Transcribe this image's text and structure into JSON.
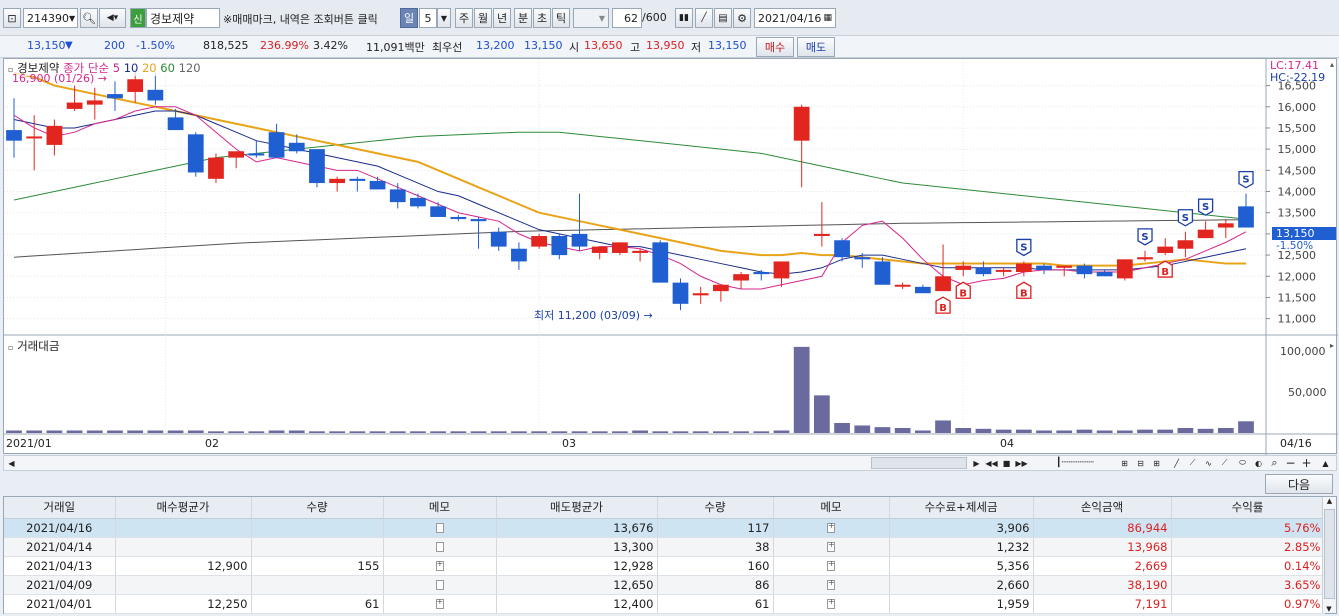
{
  "toolbar": {
    "code": "214390",
    "credit_badge": "신",
    "stock_name": "경보제약",
    "notice": "※매매마크, 내역은 조회버튼 클릭",
    "periods": [
      "일",
      "5",
      "주",
      "월",
      "년",
      "분",
      "초",
      "틱"
    ],
    "count": "62",
    "count_total": "/600",
    "date": "2021/04/16"
  },
  "quote": {
    "price": "13,150",
    "arrow": "▼",
    "change": "200",
    "change_pct": "-1.50%",
    "volume": "818,525",
    "vol_ratio": "236.99%",
    "turnover": "3.42%",
    "amount": "11,091백만",
    "best_label": "최우선",
    "best_ask": "13,200",
    "best_bid": "13,150",
    "open_label": "시",
    "open": "13,650",
    "high_label": "고",
    "high": "13,950",
    "low_label": "저",
    "low": "13,150",
    "buy_label": "매수",
    "sell_label": "매도"
  },
  "price_panel": {
    "name": "경보제약",
    "ma_label": "종가 단순",
    "ma_periods": [
      "5",
      "10",
      "20",
      "60",
      "120"
    ],
    "lc": "LC:17.41",
    "hc": "HC:-22.19",
    "high_annotation": "16,900 (01/26)",
    "low_annotation": "최저 11,200 (03/09)",
    "current_price_tag": "13,150",
    "current_pct_tag": "-1.50%"
  },
  "volume_panel": {
    "title": "거래대금",
    "axis": [
      "100,000",
      "50,000"
    ]
  },
  "x_axis": {
    "labels": [
      "2021/01",
      "02",
      "03",
      "04"
    ],
    "end_label": "04/16"
  },
  "chart_data": {
    "type": "candlestick",
    "y_axis_ticks": [
      16500,
      16000,
      15500,
      15000,
      14500,
      14000,
      13500,
      13000,
      12500,
      12000,
      11500,
      11000
    ],
    "candles": [
      {
        "o": 15450,
        "h": 16200,
        "l": 14800,
        "c": 15200
      },
      {
        "o": 15300,
        "h": 15800,
        "l": 14500,
        "c": 15300
      },
      {
        "o": 15100,
        "h": 15700,
        "l": 14850,
        "c": 15550
      },
      {
        "o": 15950,
        "h": 16500,
        "l": 15900,
        "c": 16100
      },
      {
        "o": 16050,
        "h": 16450,
        "l": 15700,
        "c": 16150
      },
      {
        "o": 16300,
        "h": 16600,
        "l": 15900,
        "c": 16200
      },
      {
        "o": 16350,
        "h": 16900,
        "l": 16100,
        "c": 16650
      },
      {
        "o": 16400,
        "h": 16800,
        "l": 16050,
        "c": 16150
      },
      {
        "o": 15750,
        "h": 15950,
        "l": 15500,
        "c": 15450
      },
      {
        "o": 15350,
        "h": 15400,
        "l": 14350,
        "c": 14450
      },
      {
        "o": 14300,
        "h": 14900,
        "l": 14200,
        "c": 14800
      },
      {
        "o": 14800,
        "h": 14950,
        "l": 14550,
        "c": 14950
      },
      {
        "o": 14900,
        "h": 15200,
        "l": 14800,
        "c": 14850
      },
      {
        "o": 15400,
        "h": 15600,
        "l": 14800,
        "c": 14800
      },
      {
        "o": 15150,
        "h": 15350,
        "l": 14900,
        "c": 14950
      },
      {
        "o": 15000,
        "h": 15000,
        "l": 14100,
        "c": 14200
      },
      {
        "o": 14200,
        "h": 14350,
        "l": 14000,
        "c": 14300
      },
      {
        "o": 14300,
        "h": 14350,
        "l": 14000,
        "c": 14250
      },
      {
        "o": 14250,
        "h": 14350,
        "l": 14050,
        "c": 14050
      },
      {
        "o": 14050,
        "h": 14200,
        "l": 13600,
        "c": 13750
      },
      {
        "o": 13850,
        "h": 13950,
        "l": 13600,
        "c": 13650
      },
      {
        "o": 13650,
        "h": 13750,
        "l": 13450,
        "c": 13400
      },
      {
        "o": 13400,
        "h": 13450,
        "l": 13300,
        "c": 13350
      },
      {
        "o": 13350,
        "h": 13400,
        "l": 12650,
        "c": 13300
      },
      {
        "o": 13050,
        "h": 13150,
        "l": 12600,
        "c": 12700
      },
      {
        "o": 12650,
        "h": 12800,
        "l": 12150,
        "c": 12350
      },
      {
        "o": 12700,
        "h": 13000,
        "l": 12650,
        "c": 12950
      },
      {
        "o": 12950,
        "h": 13000,
        "l": 12400,
        "c": 12500
      },
      {
        "o": 13000,
        "h": 13950,
        "l": 12600,
        "c": 12700
      },
      {
        "o": 12550,
        "h": 12700,
        "l": 12400,
        "c": 12700
      },
      {
        "o": 12550,
        "h": 12800,
        "l": 12500,
        "c": 12800
      },
      {
        "o": 12550,
        "h": 12650,
        "l": 12350,
        "c": 12600
      },
      {
        "o": 12800,
        "h": 12850,
        "l": 11900,
        "c": 11850
      },
      {
        "o": 11850,
        "h": 11950,
        "l": 11200,
        "c": 11350
      },
      {
        "o": 11550,
        "h": 11750,
        "l": 11350,
        "c": 11600
      },
      {
        "o": 11650,
        "h": 11800,
        "l": 11400,
        "c": 11800
      },
      {
        "o": 11900,
        "h": 12100,
        "l": 11700,
        "c": 12050
      },
      {
        "o": 12100,
        "h": 12150,
        "l": 11900,
        "c": 12050
      },
      {
        "o": 11950,
        "h": 12300,
        "l": 11750,
        "c": 12350
      },
      {
        "o": 15200,
        "h": 16050,
        "l": 14100,
        "c": 16000
      },
      {
        "o": 12950,
        "h": 13750,
        "l": 12700,
        "c": 13000
      },
      {
        "o": 12850,
        "h": 12900,
        "l": 12350,
        "c": 12450
      },
      {
        "o": 12450,
        "h": 12550,
        "l": 12200,
        "c": 12400
      },
      {
        "o": 12350,
        "h": 12450,
        "l": 11800,
        "c": 11800
      },
      {
        "o": 11800,
        "h": 11850,
        "l": 11700,
        "c": 11800
      },
      {
        "o": 11750,
        "h": 11800,
        "l": 11600,
        "c": 11600
      },
      {
        "o": 11650,
        "h": 12750,
        "l": 11650,
        "c": 12000
      },
      {
        "o": 12150,
        "h": 12350,
        "l": 12000,
        "c": 12250
      },
      {
        "o": 12200,
        "h": 12350,
        "l": 12000,
        "c": 12050
      },
      {
        "o": 12150,
        "h": 12200,
        "l": 12000,
        "c": 12150
      },
      {
        "o": 12100,
        "h": 12350,
        "l": 12000,
        "c": 12300
      },
      {
        "o": 12250,
        "h": 12300,
        "l": 12050,
        "c": 12150
      },
      {
        "o": 12200,
        "h": 12250,
        "l": 12000,
        "c": 12250
      },
      {
        "o": 12250,
        "h": 12300,
        "l": 11950,
        "c": 12050
      },
      {
        "o": 12100,
        "h": 12150,
        "l": 12000,
        "c": 12000
      },
      {
        "o": 11950,
        "h": 12400,
        "l": 11900,
        "c": 12400
      },
      {
        "o": 12400,
        "h": 12600,
        "l": 12350,
        "c": 12450
      },
      {
        "o": 12550,
        "h": 12900,
        "l": 12500,
        "c": 12700
      },
      {
        "o": 12650,
        "h": 13050,
        "l": 12450,
        "c": 12850
      },
      {
        "o": 12900,
        "h": 13300,
        "l": 12900,
        "c": 13100
      },
      {
        "o": 13150,
        "h": 13350,
        "l": 12900,
        "c": 13250
      },
      {
        "o": 13650,
        "h": 13950,
        "l": 13150,
        "c": 13150
      }
    ],
    "volume_values": [
      3,
      3,
      3,
      3,
      3,
      3,
      3,
      3,
      3,
      3,
      2,
      2,
      2,
      3,
      3,
      2,
      2,
      2,
      2,
      2,
      2,
      2,
      2,
      2,
      2,
      2,
      2,
      2,
      2,
      2,
      2,
      3,
      2,
      2,
      2,
      2,
      2,
      2,
      3,
      103,
      45,
      12,
      9,
      7,
      6,
      3,
      15,
      6,
      5,
      4,
      4,
      3,
      3,
      4,
      3,
      3,
      4,
      4,
      6,
      5,
      6,
      14
    ],
    "ma5": [
      15800,
      15500,
      15300,
      15400,
      15600,
      15700,
      15900,
      16000,
      16000,
      15800,
      15400,
      15000,
      14700,
      14800,
      14700,
      14600,
      14500,
      14500,
      14300,
      14100,
      13900,
      13700,
      13500,
      13400,
      13300,
      13000,
      12800,
      12700,
      12600,
      12700,
      12700,
      12650,
      12500,
      12300,
      12000,
      11800,
      11700,
      11700,
      11800,
      11900,
      12000,
      12800,
      13200,
      13300,
      12900,
      12400,
      12000,
      11800,
      11900,
      11950,
      12100,
      12150,
      12150,
      12100,
      12100,
      12100,
      12200,
      12300,
      12400,
      12600,
      12800,
      13050
    ],
    "ma10": [
      15700,
      15600,
      15500,
      15500,
      15600,
      15700,
      15800,
      15900,
      15900,
      15800,
      15600,
      15400,
      15200,
      15100,
      15000,
      14900,
      14800,
      14700,
      14600,
      14400,
      14200,
      14000,
      13900,
      13700,
      13500,
      13300,
      13100,
      13000,
      12900,
      12800,
      12700,
      12700,
      12600,
      12500,
      12400,
      12300,
      12200,
      12100,
      12050,
      12100,
      12200,
      12400,
      12500,
      12500,
      12400,
      12300,
      12200,
      12200,
      12200,
      12200,
      12200,
      12150,
      12150,
      12150,
      12150,
      12150,
      12200,
      12250,
      12350,
      12450,
      12550,
      12650
    ],
    "ma20": [
      16800,
      16700,
      16500,
      16400,
      16300,
      16200,
      16100,
      16000,
      15900,
      15800,
      15700,
      15600,
      15500,
      15400,
      15300,
      15200,
      15100,
      15000,
      14900,
      14800,
      14700,
      14500,
      14300,
      14100,
      13900,
      13700,
      13500,
      13400,
      13300,
      13200,
      13100,
      13000,
      12900,
      12800,
      12700,
      12600,
      12550,
      12500,
      12500,
      12550,
      12500,
      12500,
      12450,
      12400,
      12350,
      12300,
      12300,
      12300,
      12300,
      12300,
      12300,
      12300,
      12250,
      12250,
      12250,
      12250,
      12300,
      12350,
      12400,
      12350,
      12300,
      12300
    ],
    "ma60": [
      13800,
      13900,
      14000,
      14100,
      14200,
      14300,
      14400,
      14500,
      14600,
      14700,
      14800,
      14850,
      14900,
      14950,
      15000,
      15050,
      15100,
      15150,
      15200,
      15250,
      15300,
      15320,
      15340,
      15360,
      15380,
      15400,
      15400,
      15400,
      15350,
      15300,
      15250,
      15200,
      15150,
      15100,
      15050,
      15000,
      14950,
      14900,
      14800,
      14700,
      14600,
      14500,
      14400,
      14300,
      14200,
      14150,
      14100,
      14050,
      14000,
      13950,
      13900,
      13850,
      13800,
      13750,
      13700,
      13650,
      13600,
      13550,
      13500,
      13450,
      13400,
      13350
    ],
    "ma120": [
      12450,
      12480,
      12510,
      12540,
      12570,
      12600,
      12630,
      12660,
      12690,
      12720,
      12750,
      12780,
      12800,
      12820,
      12840,
      12860,
      12880,
      12900,
      12920,
      12940,
      12960,
      12980,
      13000,
      13020,
      13040,
      13060,
      13070,
      13080,
      13090,
      13100,
      13110,
      13120,
      13130,
      13140,
      13150,
      13160,
      13170,
      13180,
      13190,
      13200,
      13210,
      13220,
      13230,
      13240,
      13250,
      13255,
      13260,
      13265,
      13270,
      13275,
      13280,
      13285,
      13290,
      13295,
      13300,
      13305,
      13310,
      13315,
      13320,
      13325,
      13330,
      13335
    ],
    "buy_marks_at": [
      46,
      47,
      50,
      57
    ],
    "sell_marks_at": [
      50,
      56,
      58,
      59,
      61
    ]
  },
  "table": {
    "next_button": "다음",
    "headers": [
      "거래일",
      "매수평균가",
      "수량",
      "메모",
      "매도평균가",
      "수량",
      "메모",
      "수수료+제세금",
      "손익금액",
      "수익률"
    ],
    "rows": [
      {
        "date": "2021/04/16",
        "buy_avg": "",
        "buy_qty": "",
        "buy_memo": "empty",
        "sell_avg": "13,676",
        "sell_qty": "117",
        "sell_memo": "plus",
        "fee": "3,906",
        "pnl": "86,944",
        "rate": "5.76%"
      },
      {
        "date": "2021/04/14",
        "buy_avg": "",
        "buy_qty": "",
        "buy_memo": "empty",
        "sell_avg": "13,300",
        "sell_qty": "38",
        "sell_memo": "plus",
        "fee": "1,232",
        "pnl": "13,968",
        "rate": "2.85%"
      },
      {
        "date": "2021/04/13",
        "buy_avg": "12,900",
        "buy_qty": "155",
        "buy_memo": "plus",
        "sell_avg": "12,928",
        "sell_qty": "160",
        "sell_memo": "plus",
        "fee": "5,356",
        "pnl": "2,669",
        "rate": "0.14%"
      },
      {
        "date": "2021/04/09",
        "buy_avg": "",
        "buy_qty": "",
        "buy_memo": "empty",
        "sell_avg": "12,650",
        "sell_qty": "86",
        "sell_memo": "plus",
        "fee": "2,660",
        "pnl": "38,190",
        "rate": "3.65%"
      },
      {
        "date": "2021/04/01",
        "buy_avg": "12,250",
        "buy_qty": "61",
        "buy_memo": "plus",
        "sell_avg": "12,400",
        "sell_qty": "61",
        "sell_memo": "plus",
        "fee": "1,959",
        "pnl": "7,191",
        "rate": "0.97%"
      }
    ]
  },
  "colors": {
    "up": "#e2261f",
    "down": "#1f5fd1",
    "ma5": "#d6268c",
    "ma10": "#1a2c8c",
    "ma20": "#e8a317",
    "ma60": "#2e8b3a",
    "ma120": "#555555",
    "volume": "#6a6a9e"
  }
}
